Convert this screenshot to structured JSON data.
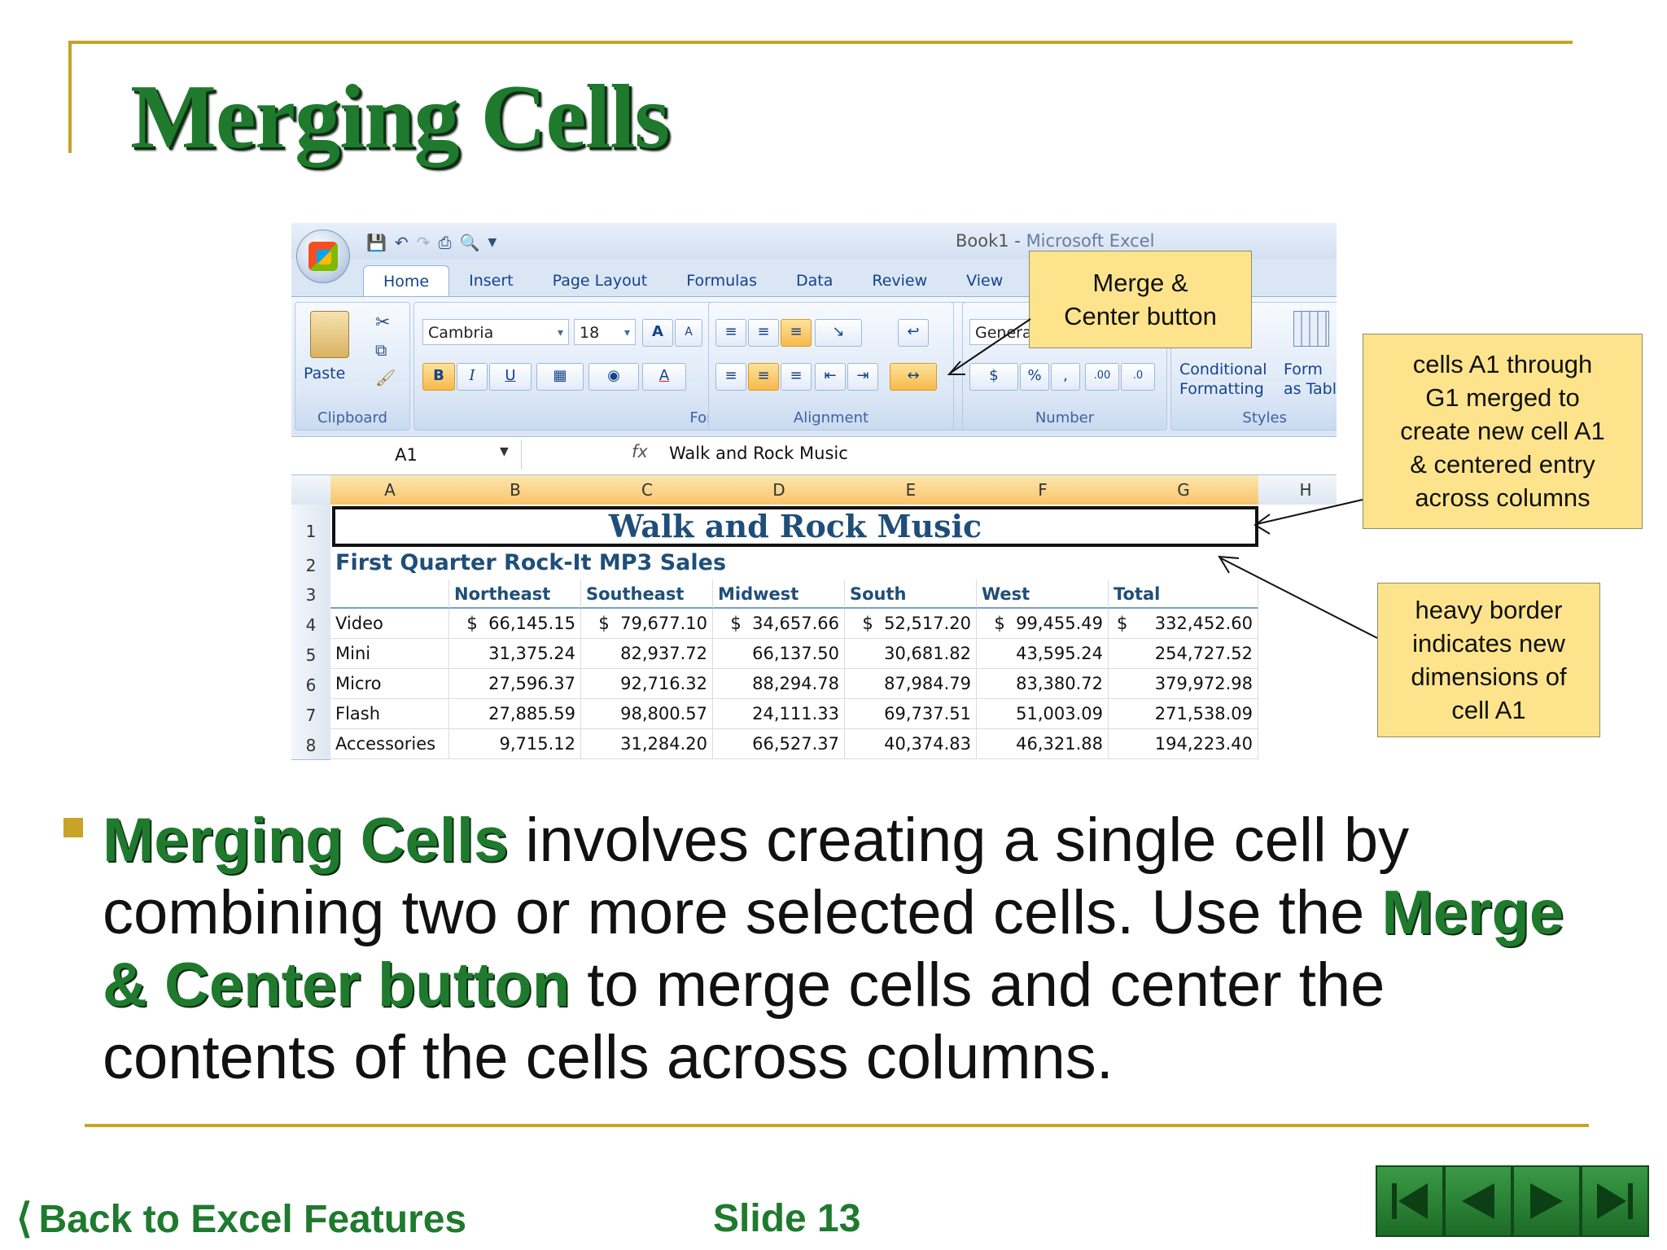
{
  "slide": {
    "title": "Merging Cells",
    "body": {
      "kw1": "Merging Cells",
      "text1": " involves creating a single cell by combining two or more selected cells.  Use the ",
      "kw2": "Merge & Center button",
      "text2": " to merge cells and center the contents of the cells across columns."
    },
    "back_link": "Back to Excel Features",
    "slide_number": "Slide 13",
    "accent_color": "#c9a227",
    "title_color": "#1f7a2e"
  },
  "excel": {
    "window_title": "Book1 - ",
    "app_name": "Microsoft Excel",
    "tabs": [
      "Home",
      "Insert",
      "Page Layout",
      "Formulas",
      "Data",
      "Review",
      "View"
    ],
    "ribbon": {
      "paste": "Paste",
      "clipboard": "Clipboard",
      "font_name": "Cambria",
      "font_size": "18",
      "font": "Font",
      "alignment": "Alignment",
      "number_format": "General",
      "number": "Number",
      "conditional_formatting_line1": "Conditional",
      "conditional_formatting_line2": "Formatting",
      "format_as_table_line1": "Form",
      "format_as_table_line2": "as Tabl",
      "styles": "Styles"
    },
    "name_box": "A1",
    "formula_value": "Walk and Rock Music",
    "columns": [
      "A",
      "B",
      "C",
      "D",
      "E",
      "F",
      "G",
      "H"
    ],
    "rows": [
      "1",
      "2",
      "3",
      "4",
      "5",
      "6",
      "7",
      "8"
    ],
    "merged_title": "Walk and Rock Music",
    "subtitle": "First Quarter Rock-It MP3 Sales",
    "headers": [
      "",
      "Northeast",
      "Southeast",
      "Midwest",
      "South",
      "West",
      "Total"
    ],
    "data": [
      [
        "Video",
        "$  66,145.15",
        "$  79,677.10",
        "$  34,657.66",
        "$  52,517.20",
        "$  99,455.49",
        "$     332,452.60"
      ],
      [
        "Mini",
        "31,375.24",
        "82,937.72",
        "66,137.50",
        "30,681.82",
        "43,595.24",
        "254,727.52"
      ],
      [
        "Micro",
        "27,596.37",
        "92,716.32",
        "88,294.78",
        "87,984.79",
        "83,380.72",
        "379,972.98"
      ],
      [
        "Flash",
        "27,885.59",
        "98,800.57",
        "24,111.33",
        "69,737.51",
        "51,003.09",
        "271,538.09"
      ],
      [
        "Accessories",
        "9,715.12",
        "31,284.20",
        "66,527.37",
        "40,374.83",
        "46,321.88",
        "194,223.40"
      ]
    ]
  },
  "callouts": {
    "merge_button_line1": "Merge &",
    "merge_button_line2": "Center button",
    "cells_merged_lines": [
      "cells A1 through",
      "G1 merged to",
      "create new cell A1",
      "& centered  entry",
      "across columns"
    ],
    "heavy_border_lines": [
      "heavy border",
      "indicates new",
      "dimensions of",
      "cell A1"
    ]
  }
}
